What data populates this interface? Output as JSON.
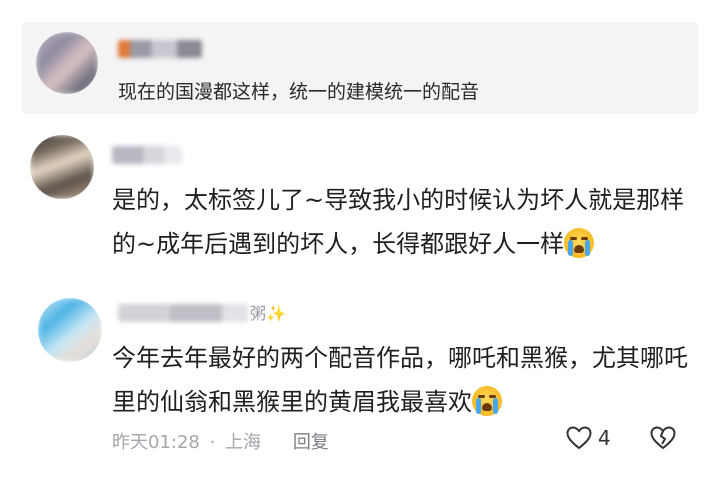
{
  "quoted_comment": {
    "text": "现在的国漫都这样，统一的建模统一的配音"
  },
  "comment_1": {
    "text": "是的，太标签儿了~导致我小的时候认为坏人就是那样的~成年后遇到的坏人，长得都跟好人一样",
    "emoji": "crying-face-icon"
  },
  "comment_2": {
    "name_suffix": "粥✨",
    "text": "今年去年最好的两个配音作品，哪吒和黑猴，尤其哪吒里的仙翁和黑猴里的黄眉我最喜欢",
    "emoji": "crying-laughing-face-icon",
    "time": "昨天01:28",
    "separator": "·",
    "location": "上海",
    "reply_label": "回复",
    "like_count": "4"
  }
}
